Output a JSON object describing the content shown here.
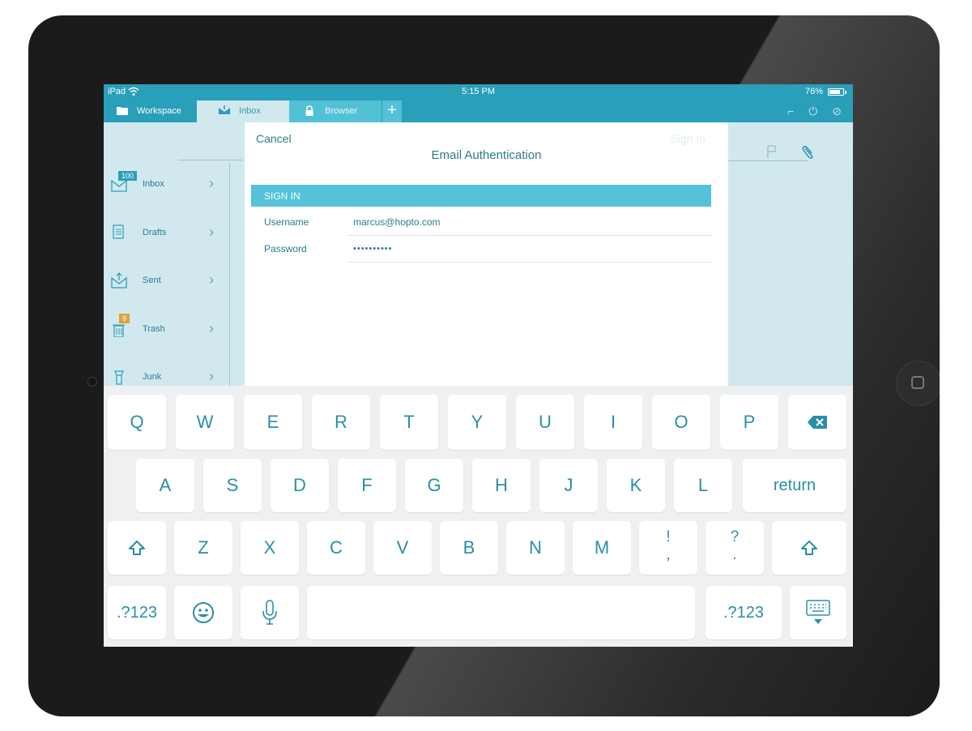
{
  "status": {
    "carrier": "iPad",
    "time": "5:15 PM",
    "battery": "76%"
  },
  "tabs": [
    {
      "label": "Workspace",
      "icon": "folder-icon"
    },
    {
      "label": "Inbox",
      "icon": "inbox-icon"
    },
    {
      "label": "Browser",
      "icon": "lock-icon"
    },
    {
      "label": "+",
      "icon": "plus-icon"
    }
  ],
  "sidebar": {
    "items": [
      {
        "label": "Inbox",
        "badge": "100",
        "icon": "inbox-tray-icon"
      },
      {
        "label": "Drafts",
        "icon": "drafts-icon"
      },
      {
        "label": "Sent",
        "icon": "sent-icon"
      },
      {
        "label": "Trash",
        "badge": "9",
        "icon": "trash-icon"
      },
      {
        "label": "Junk",
        "icon": "junk-icon"
      }
    ]
  },
  "modal": {
    "cancel": "Cancel",
    "signin": "Sign In",
    "title": "Email Authentication",
    "section": "SIGN IN",
    "username_label": "Username",
    "username_value": "marcus@hopto.com",
    "password_label": "Password",
    "password_value": "••••••••••"
  },
  "keyboard": {
    "row1": [
      "Q",
      "W",
      "E",
      "R",
      "T",
      "Y",
      "U",
      "I",
      "O",
      "P"
    ],
    "row2": [
      "A",
      "S",
      "D",
      "F",
      "G",
      "H",
      "J",
      "K",
      "L"
    ],
    "return_label": "return",
    "row3": [
      "Z",
      "X",
      "C",
      "V",
      "B",
      "N",
      "M"
    ],
    "punct1_top": "!",
    "punct1_bottom": ",",
    "punct2_top": "?",
    "punct2_bottom": ".",
    "numbers_label": ".?123",
    "colors": {
      "accent": "#2a9fba",
      "key_text": "#2a8fa6"
    }
  }
}
